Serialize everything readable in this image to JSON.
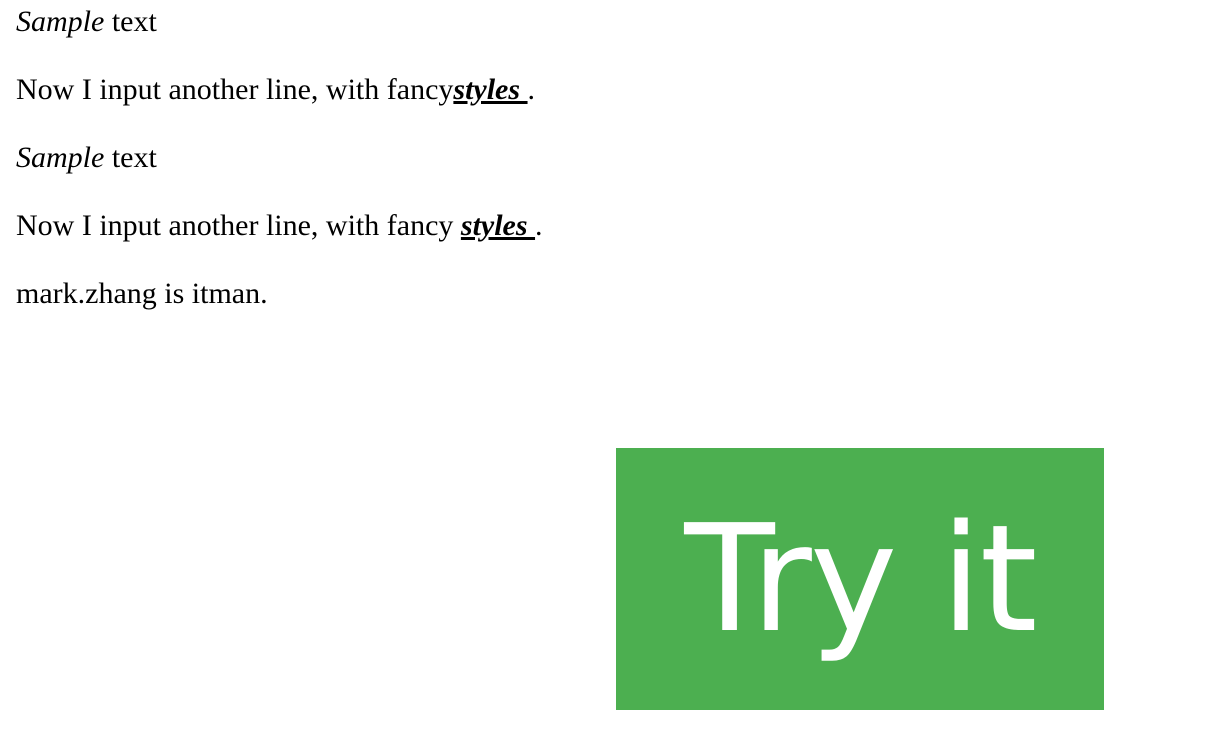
{
  "paragraphs": [
    {
      "italic_word": "Sample",
      "rest": " text"
    },
    {
      "prefix": "Now I input another line, with fancy",
      "fancy_word": "styles ",
      "suffix": "."
    },
    {
      "italic_word": "Sample",
      "rest": " text"
    },
    {
      "prefix": "Now I input another line, with fancy ",
      "fancy_word": "styles ",
      "suffix": "."
    },
    {
      "text": "mark.zhang is itman."
    }
  ],
  "button": {
    "label": "Try it",
    "color": "#4caf50",
    "text_color": "#ffffff"
  }
}
